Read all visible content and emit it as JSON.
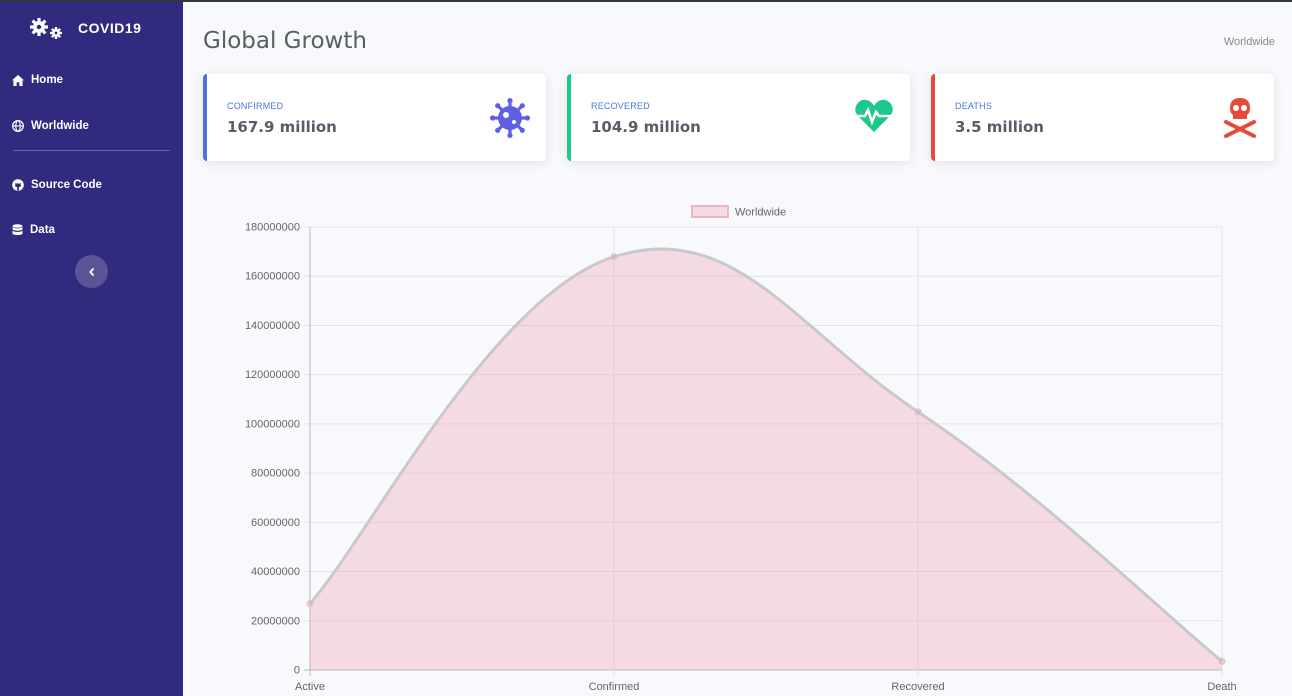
{
  "app": {
    "brand": "COVID19"
  },
  "sidebar": {
    "items": [
      {
        "label": "Home",
        "icon": "home-icon"
      },
      {
        "label": "Worldwide",
        "icon": "globe-icon"
      },
      {
        "label": "Source Code",
        "icon": "github-icon"
      },
      {
        "label": "Data",
        "icon": "database-icon"
      }
    ],
    "toggle_icon": "chevron-left-icon"
  },
  "header": {
    "title": "Global Growth",
    "breadcrumb": "Worldwide"
  },
  "cards": [
    {
      "label": "CONFIRMED",
      "value": "167.9 million",
      "icon": "virus-icon",
      "color": "#4e73df"
    },
    {
      "label": "RECOVERED",
      "value": "104.9 million",
      "icon": "heartbeat-icon",
      "color": "#1cc88a"
    },
    {
      "label": "DEATHS",
      "value": "3.5 million",
      "icon": "skull-crossbones-icon",
      "color": "#e74a3b"
    }
  ],
  "colors": {
    "sidebar_bg": "#302b7e",
    "series_fill": "rgba(240,160,180,0.35)",
    "series_line": "#c9c9cb"
  },
  "chart_data": {
    "type": "area",
    "categories": [
      "Active",
      "Confirmed",
      "Recovered",
      "Death"
    ],
    "series": [
      {
        "name": "Worldwide",
        "values": [
          27000000,
          167900000,
          104900000,
          3500000
        ]
      }
    ],
    "ylim": [
      0,
      180000000
    ],
    "yticks": [
      "0",
      "20000000",
      "40000000",
      "60000000",
      "80000000",
      "100000000",
      "120000000",
      "140000000",
      "160000000",
      "180000000"
    ],
    "legend": "top",
    "grid": true
  }
}
